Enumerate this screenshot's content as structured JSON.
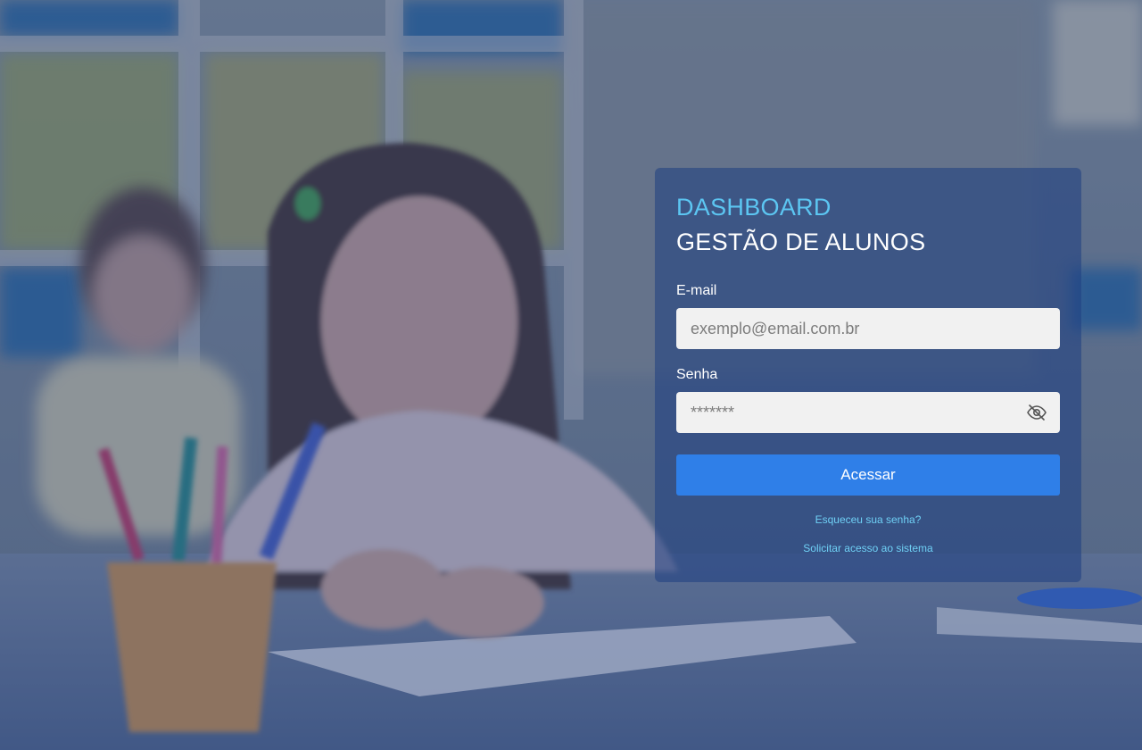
{
  "login": {
    "brand": "DASHBOARD",
    "title": "GESTÃO DE ALUNOS",
    "email_label": "E-mail",
    "email_placeholder": "exemplo@email.com.br",
    "email_value": "",
    "password_label": "Senha",
    "password_placeholder": "*******",
    "password_value": "",
    "password_toggle_icon": "eye-slash-icon",
    "submit_label": "Acessar",
    "forgot_link": "Esqueceu sua senha?",
    "request_access_link": "Solicitar acesso ao sistema"
  },
  "colors": {
    "brand": "#5cc6f2",
    "button": "#2f7fe8",
    "link": "#6fd0f5",
    "card": "rgba(30, 62, 130, 0.55)"
  }
}
